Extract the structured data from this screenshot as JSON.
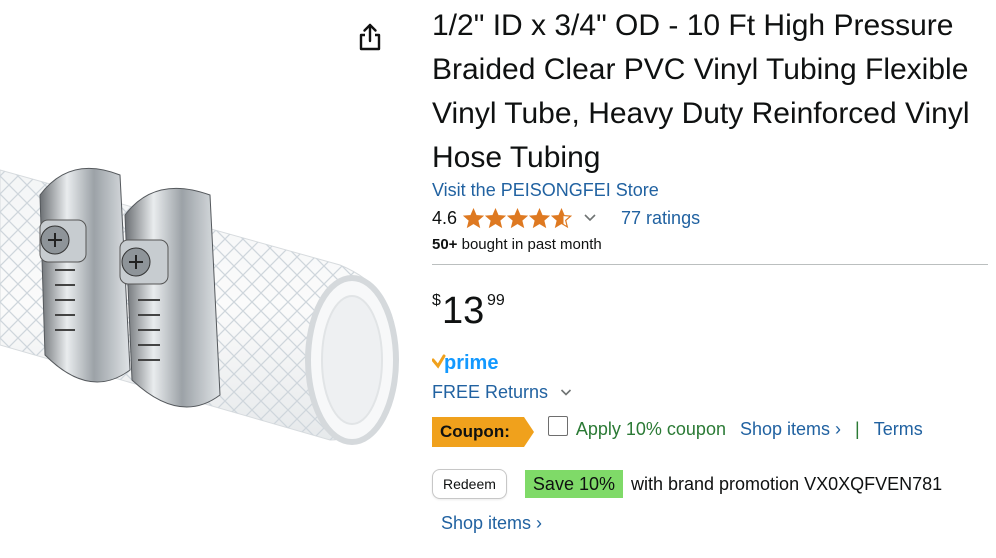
{
  "product": {
    "title": "1/2\" ID x 3/4\" OD - 10 Ft High Pressure Braided Clear PVC Vinyl Tubing Flexible Vinyl Tube, Heavy Duty Reinforced Vinyl Hose Tubing",
    "store_link": "Visit the PEISONGFEI Store",
    "rating_value": "4.6",
    "rating_stars": 4.6,
    "ratings_count": "77 ratings",
    "bought_count": "50+",
    "bought_text": " bought in past month"
  },
  "price": {
    "symbol": "$",
    "whole": "13",
    "fraction": "99"
  },
  "delivery": {
    "prime_label": "prime",
    "free_returns": "FREE Returns"
  },
  "coupon": {
    "badge": "Coupon:",
    "apply_text": "Apply 10% coupon",
    "shop_items": "Shop items ›",
    "separator": "|",
    "terms": "Terms"
  },
  "promo": {
    "redeem": "Redeem",
    "save": "Save 10%",
    "text": "with brand promotion VX0XQFVEN781",
    "shop_items": "Shop items ›"
  },
  "colors": {
    "link": "#2162a1",
    "star": "#de7921",
    "coupon_badge": "#f0a11c",
    "save_badge": "#7fda68",
    "coupon_text": "#2b7a35",
    "prime": "#1399ff"
  },
  "icons": {
    "share": "share-icon",
    "chevron": "chevron-down-icon"
  }
}
